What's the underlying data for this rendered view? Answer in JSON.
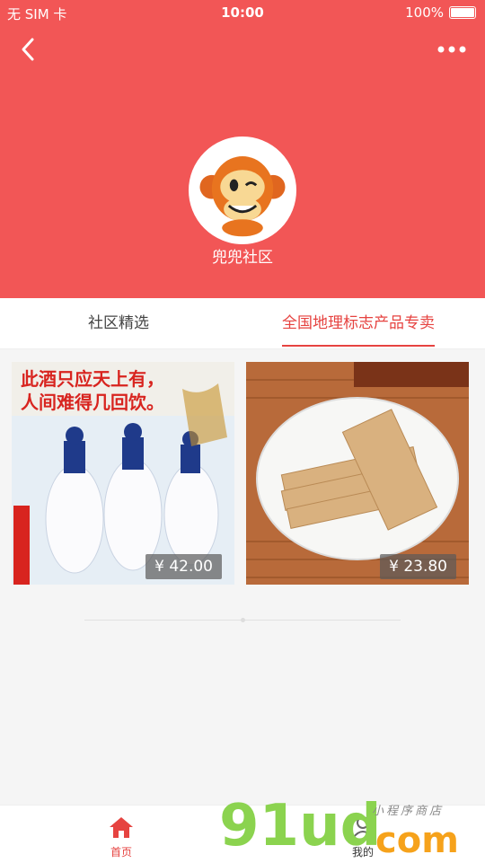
{
  "status_bar": {
    "carrier": "无 SIM 卡",
    "time": "10:00",
    "battery": "100%"
  },
  "header": {
    "community_name": "兜兜社区"
  },
  "tabs": [
    {
      "label": "社区精选"
    },
    {
      "label": "全国地理标志产品专卖"
    }
  ],
  "products": [
    {
      "price": "¥ 42.00",
      "image_text_1": "此酒只应天上有，",
      "image_text_2": "人间难得几回饮。"
    },
    {
      "price": "¥ 23.80"
    }
  ],
  "tabbar": {
    "home": "首页",
    "mine": "我的"
  },
  "watermark": {
    "main": "91ud",
    "suffix": "com",
    "tagline": "小程序商店"
  },
  "colors": {
    "brand": "#f25656",
    "accent": "#e64340"
  }
}
